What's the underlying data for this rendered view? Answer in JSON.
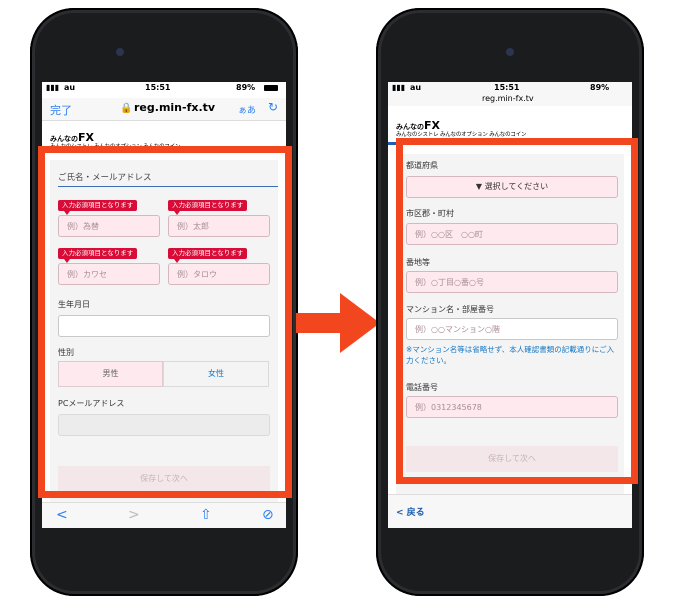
{
  "left_phone": {
    "status": {
      "carrier": "au",
      "time": "15:51",
      "battery": "89%"
    },
    "browser": {
      "done_label": "完了",
      "url": "reg.min-fx.tv",
      "text_size_label": "ぁあ"
    },
    "brand": {
      "logo_small": "みんなの",
      "logo_fx": "FX",
      "sub_links": "みんなのシストレ  みんなのオプション  みんなのコイン"
    },
    "form": {
      "section_title": "ご氏名・メールアドレス",
      "badge_text": "入力必須項目となります",
      "last_name_ph": "例）為替",
      "first_name_ph": "例）太郎",
      "last_kana_ph": "例）カワセ",
      "first_kana_ph": "例）タロウ",
      "birthdate_label": "生年月日",
      "gender_label": "性別",
      "gender_male": "男性",
      "gender_female": "女性",
      "email_label": "PCメールアドレス",
      "save_button": "保存して次へ"
    },
    "toolbar": {
      "back": "<",
      "forward": ">",
      "share": "⇧",
      "compass": "⊘"
    }
  },
  "right_phone": {
    "status": {
      "carrier": "au",
      "time": "15:51",
      "battery": "89%",
      "url": "reg.min-fx.tv"
    },
    "brand": {
      "logo_small": "みんなの",
      "logo_fx": "FX",
      "sub_links": "みんなのシストレ  みんなのオプション  みんなのコイン"
    },
    "form": {
      "prefecture_label": "都道府県",
      "prefecture_select": "▼ 選択してください",
      "city_label": "市区郡・町村",
      "city_ph": "例）○○区　○○町",
      "address_label": "番地等",
      "address_ph": "例）○丁目○番○号",
      "building_label": "マンション名・部屋番号",
      "building_ph": "例）○○マンション○階",
      "note": "※マンション名等は省略せず、本人確認書類の記載通りにご入力ください。",
      "phone_label": "電話番号",
      "phone_ph": "例）0312345678",
      "save_button": "保存して次へ"
    },
    "toolbar": {
      "back_label": "< 戻る"
    }
  },
  "colors": {
    "accent_orange": "#f2471e",
    "required_red": "#d80c36",
    "link_blue": "#1577c4",
    "field_pink": "#fde9ee"
  }
}
